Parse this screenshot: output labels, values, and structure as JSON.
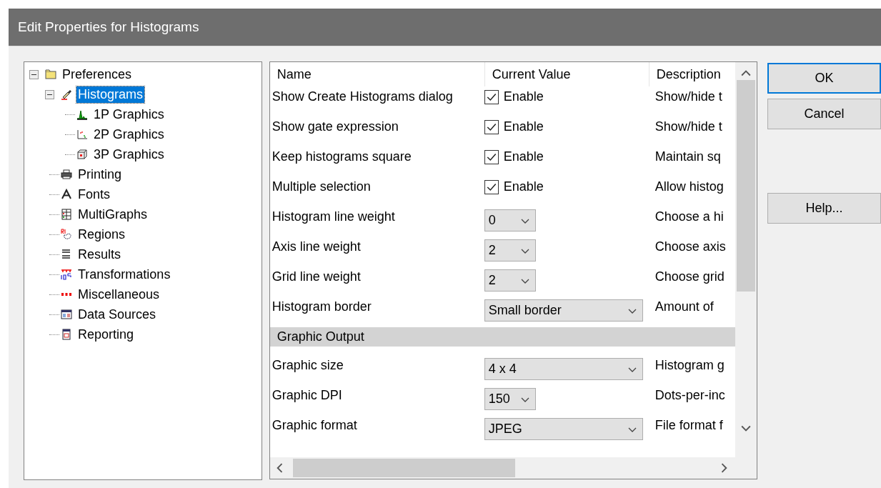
{
  "window": {
    "title": "Edit Properties for Histograms"
  },
  "tree": [
    {
      "label": "Preferences",
      "expanded": true,
      "selected": false,
      "children": [
        {
          "label": "Histograms",
          "expanded": true,
          "selected": true,
          "children": [
            {
              "label": "1P Graphics",
              "selected": false
            },
            {
              "label": "2P Graphics",
              "selected": false
            },
            {
              "label": "3P Graphics",
              "selected": false
            }
          ]
        },
        {
          "label": "Printing",
          "selected": false
        },
        {
          "label": "Fonts",
          "selected": false
        },
        {
          "label": "MultiGraphs",
          "selected": false
        },
        {
          "label": "Regions",
          "selected": false
        },
        {
          "label": "Results",
          "selected": false
        },
        {
          "label": "Transformations",
          "selected": false
        },
        {
          "label": "Miscellaneous",
          "selected": false
        },
        {
          "label": "Data Sources",
          "selected": false
        },
        {
          "label": "Reporting",
          "selected": false
        }
      ]
    }
  ],
  "grid": {
    "columns": [
      "Name",
      "Current Value",
      "Description"
    ],
    "rows": [
      {
        "kind": "check",
        "name": "Show Create Histograms dialog",
        "value": "Enable",
        "checked": true,
        "description": "Show/hide t"
      },
      {
        "kind": "check",
        "name": "Show gate expression",
        "value": "Enable",
        "checked": true,
        "description": "Show/hide t"
      },
      {
        "kind": "check",
        "name": "Keep histograms square",
        "value": "Enable",
        "checked": true,
        "description": "Maintain sq"
      },
      {
        "kind": "check",
        "name": "Multiple selection",
        "value": "Enable",
        "checked": true,
        "description": "Allow histog"
      },
      {
        "kind": "dropdown",
        "name": "Histogram line weight",
        "value": "0",
        "wide": false,
        "description": "Choose a hi"
      },
      {
        "kind": "dropdown",
        "name": "Axis line weight",
        "value": "2",
        "wide": false,
        "description": "Choose axis"
      },
      {
        "kind": "dropdown",
        "name": "Grid line weight",
        "value": "2",
        "wide": false,
        "description": "Choose grid"
      },
      {
        "kind": "dropdown",
        "name": "Histogram border",
        "value": "Small border",
        "wide": true,
        "description": "Amount of"
      },
      {
        "kind": "section",
        "name": "Graphic Output"
      },
      {
        "kind": "dropdown",
        "name": "Graphic size",
        "value": "4 x 4",
        "wide": true,
        "description": "Histogram g"
      },
      {
        "kind": "dropdown",
        "name": "Graphic DPI",
        "value": "150",
        "wide": false,
        "description": "Dots-per-inc"
      },
      {
        "kind": "dropdown",
        "name": "Graphic format",
        "value": "JPEG",
        "wide": true,
        "description": "File format f"
      }
    ]
  },
  "buttons": [
    {
      "label": "OK",
      "default": true
    },
    {
      "label": "Cancel",
      "default": false
    },
    {
      "label": "Help...",
      "default": false
    }
  ]
}
